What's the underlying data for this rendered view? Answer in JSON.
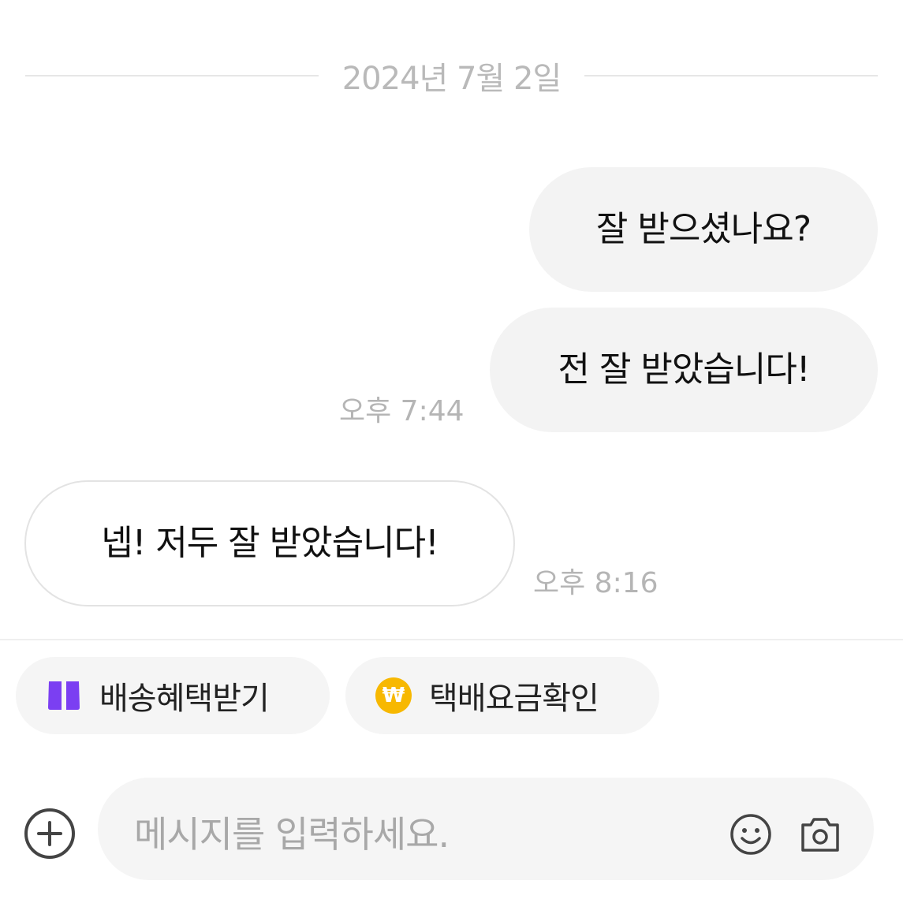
{
  "date_separator": "2024년 7월 2일",
  "messages": [
    {
      "direction": "outgoing",
      "text": "잘 받으셨나요?"
    },
    {
      "direction": "outgoing",
      "text": "전 잘 받았습니다!",
      "time": "오후 7:44"
    },
    {
      "direction": "incoming",
      "text": "넵! 저두 잘 받았습니다!",
      "time": "오후 8:16"
    }
  ],
  "quick_actions": [
    {
      "label": "배송혜택받기",
      "icon": "purple-box-icon",
      "icon_color": "#7b3ff2"
    },
    {
      "label": "택배요금확인",
      "icon": "won-coin-icon",
      "icon_color": "#f7b801",
      "icon_glyph": "₩"
    }
  ],
  "composer": {
    "placeholder": "메시지를 입력하세요.",
    "icons": [
      "plus-circle-icon",
      "smile-icon",
      "camera-icon"
    ]
  }
}
